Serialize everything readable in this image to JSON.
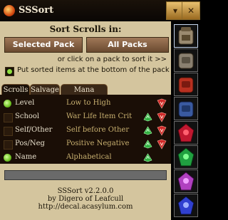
{
  "window": {
    "title": "SSSort"
  },
  "titlebar": {
    "minimize_glyph": "▾",
    "close_glyph": "✕"
  },
  "sort_scrolls": {
    "heading": "Sort Scrolls in:",
    "selected_pack_label": "Selected Pack",
    "all_packs_label": "All Packs",
    "hint": "or click on a pack to sort it >>",
    "bottom_checkbox_label": "Put sorted items at the bottom of the pack"
  },
  "tabs": [
    {
      "label": "Scrolls"
    },
    {
      "label": "Salvage"
    },
    {
      "label": "Mana Stones"
    }
  ],
  "sort_rules": [
    {
      "label": "Level",
      "value": "Low to High",
      "enabled": true
    },
    {
      "label": "School",
      "value": "War Life Item Crit",
      "enabled": false
    },
    {
      "label": "Self/Other",
      "value": "Self before Other",
      "enabled": false
    },
    {
      "label": "Pos/Neg",
      "value": "Positive Negative",
      "enabled": false
    },
    {
      "label": "Name",
      "value": "Alphabetical",
      "enabled": true
    }
  ],
  "progress": {
    "fraction": 0
  },
  "footer": {
    "version": "SSSort v2.2.0.0",
    "author": "by Digero of Leafcull",
    "url": "http://decal.acasylum.com"
  },
  "packs": [
    {
      "name": "main-pack-icon",
      "color": "#9a8a70"
    },
    {
      "name": "grey-pack-icon",
      "color": "#8a8070"
    },
    {
      "name": "red-pack-icon",
      "color": "#b83020"
    },
    {
      "name": "blue-pack-icon",
      "color": "#3a5aa0"
    },
    {
      "name": "crimson-pack-icon",
      "color": "#c01830"
    },
    {
      "name": "green-pack-icon",
      "color": "#20a040"
    },
    {
      "name": "purple-pack-icon",
      "color": "#b040c0"
    },
    {
      "name": "royal-blue-pack-icon",
      "color": "#3040d0"
    }
  ],
  "colors": {
    "panel_bg": "#d4c59e",
    "list_bg": "#1a0e06",
    "button_bg": "#8a6244",
    "enabled_green": "#8fe040"
  }
}
